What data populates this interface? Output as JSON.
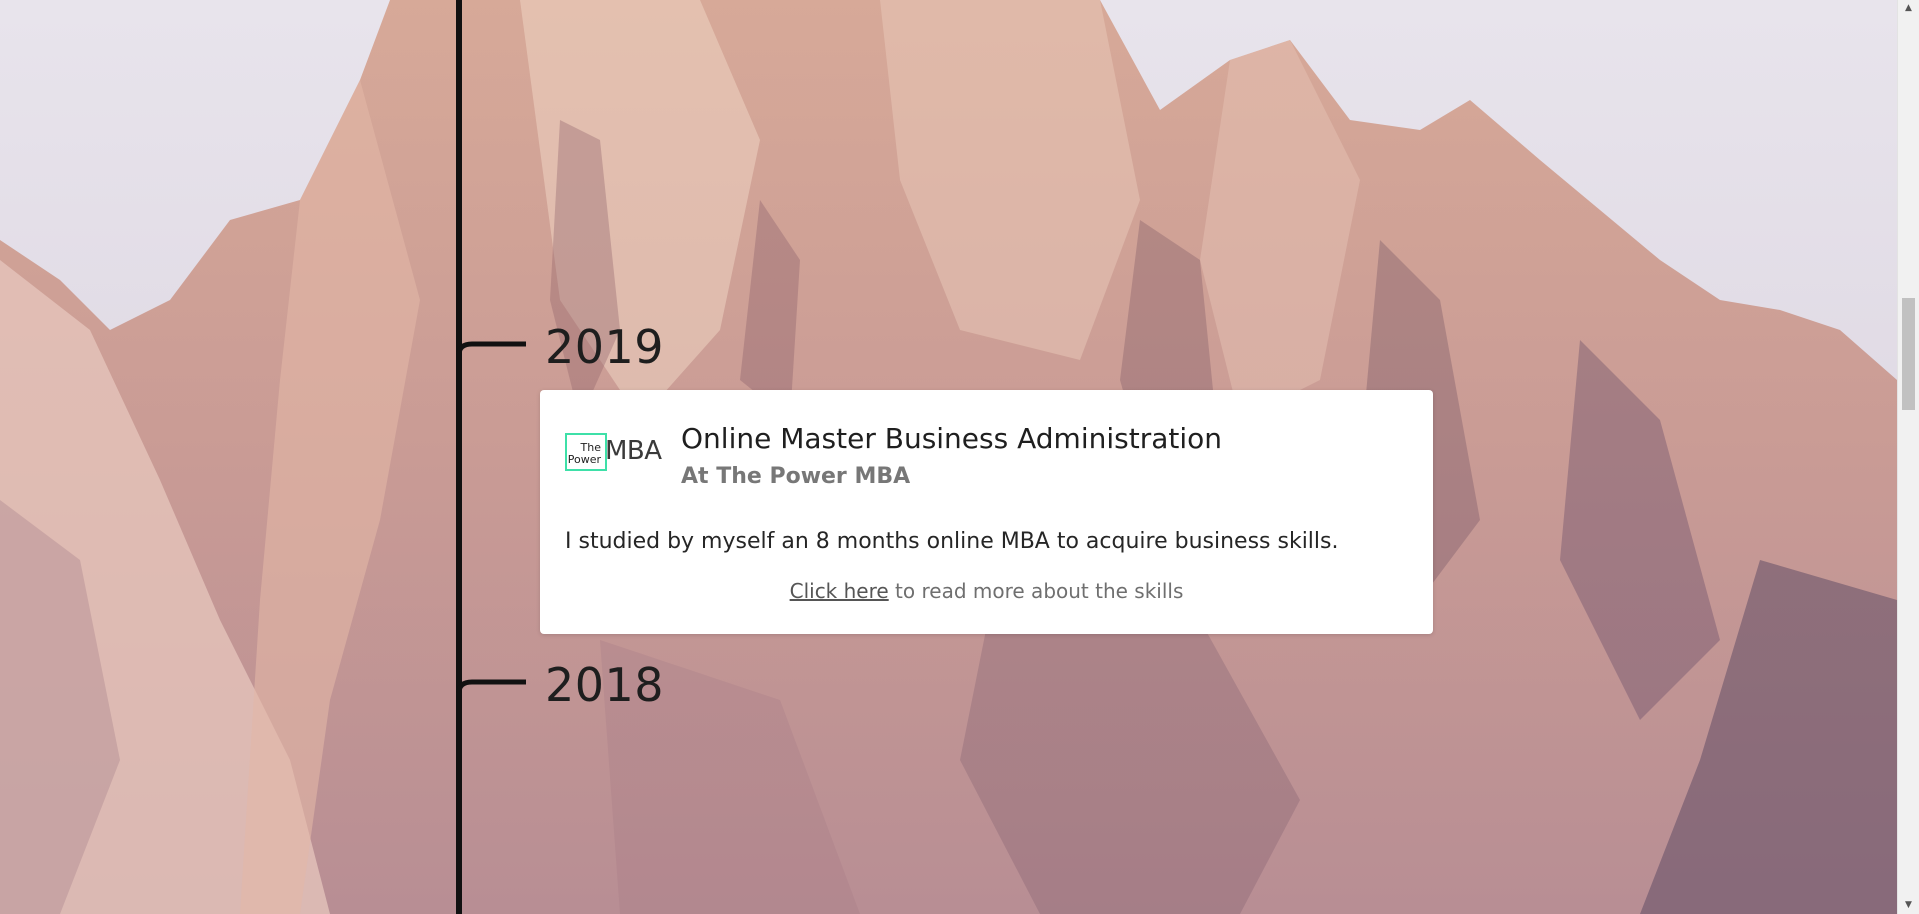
{
  "timeline": {
    "years": [
      "2019",
      "2018"
    ]
  },
  "entry": {
    "logo_small": "The\nPower",
    "logo_large": "MBA",
    "title": "Online Master Business Administration",
    "subtitle": "At The Power MBA",
    "description": "I studied by myself an 8 months online MBA to acquire business skills.",
    "link_label": "Click here",
    "link_suffix": " to read more about the skills"
  },
  "colors": {
    "logo_accent": "#3ee0a8",
    "timeline": "#111111"
  }
}
